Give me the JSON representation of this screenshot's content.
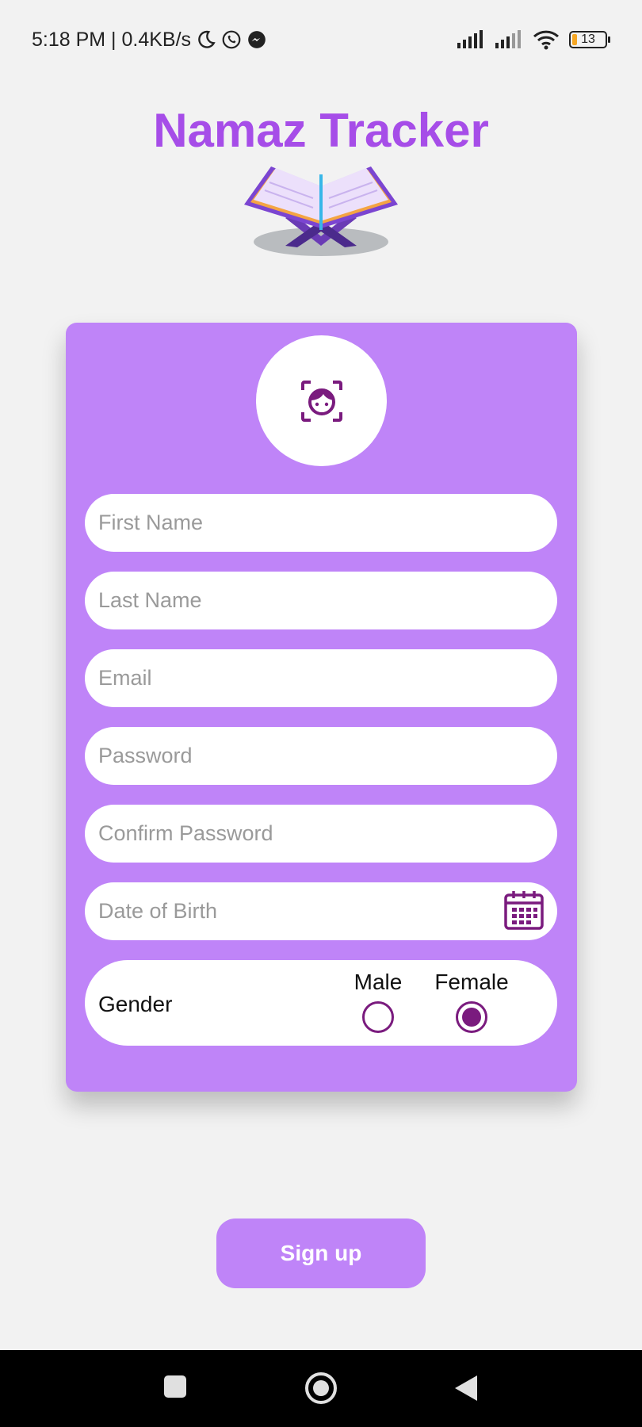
{
  "status_bar": {
    "time_speed": "5:18 PM | 0.4KB/s",
    "battery_level": "13",
    "icons": [
      "moon-icon",
      "whatsapp-icon",
      "messenger-icon",
      "signal-icon",
      "signal-icon",
      "wifi-icon",
      "battery-icon"
    ]
  },
  "app": {
    "title": "Namaz Tracker",
    "accent_color": "#a64de8",
    "card_color": "#bf84f8"
  },
  "form": {
    "avatar_icon": "face-scan-icon",
    "first_name_placeholder": "First Name",
    "last_name_placeholder": "Last Name",
    "email_placeholder": "Email",
    "password_placeholder": "Password",
    "confirm_password_placeholder": "Confirm Password",
    "dob_placeholder": "Date of Birth",
    "dob_icon": "calendar-icon",
    "gender_label": "Gender",
    "gender_options": [
      {
        "label": "Male",
        "selected": false
      },
      {
        "label": "Female",
        "selected": true
      }
    ]
  },
  "actions": {
    "signup_label": "Sign up"
  },
  "nav": {
    "icons": [
      "recents-icon",
      "home-icon",
      "back-icon"
    ]
  }
}
